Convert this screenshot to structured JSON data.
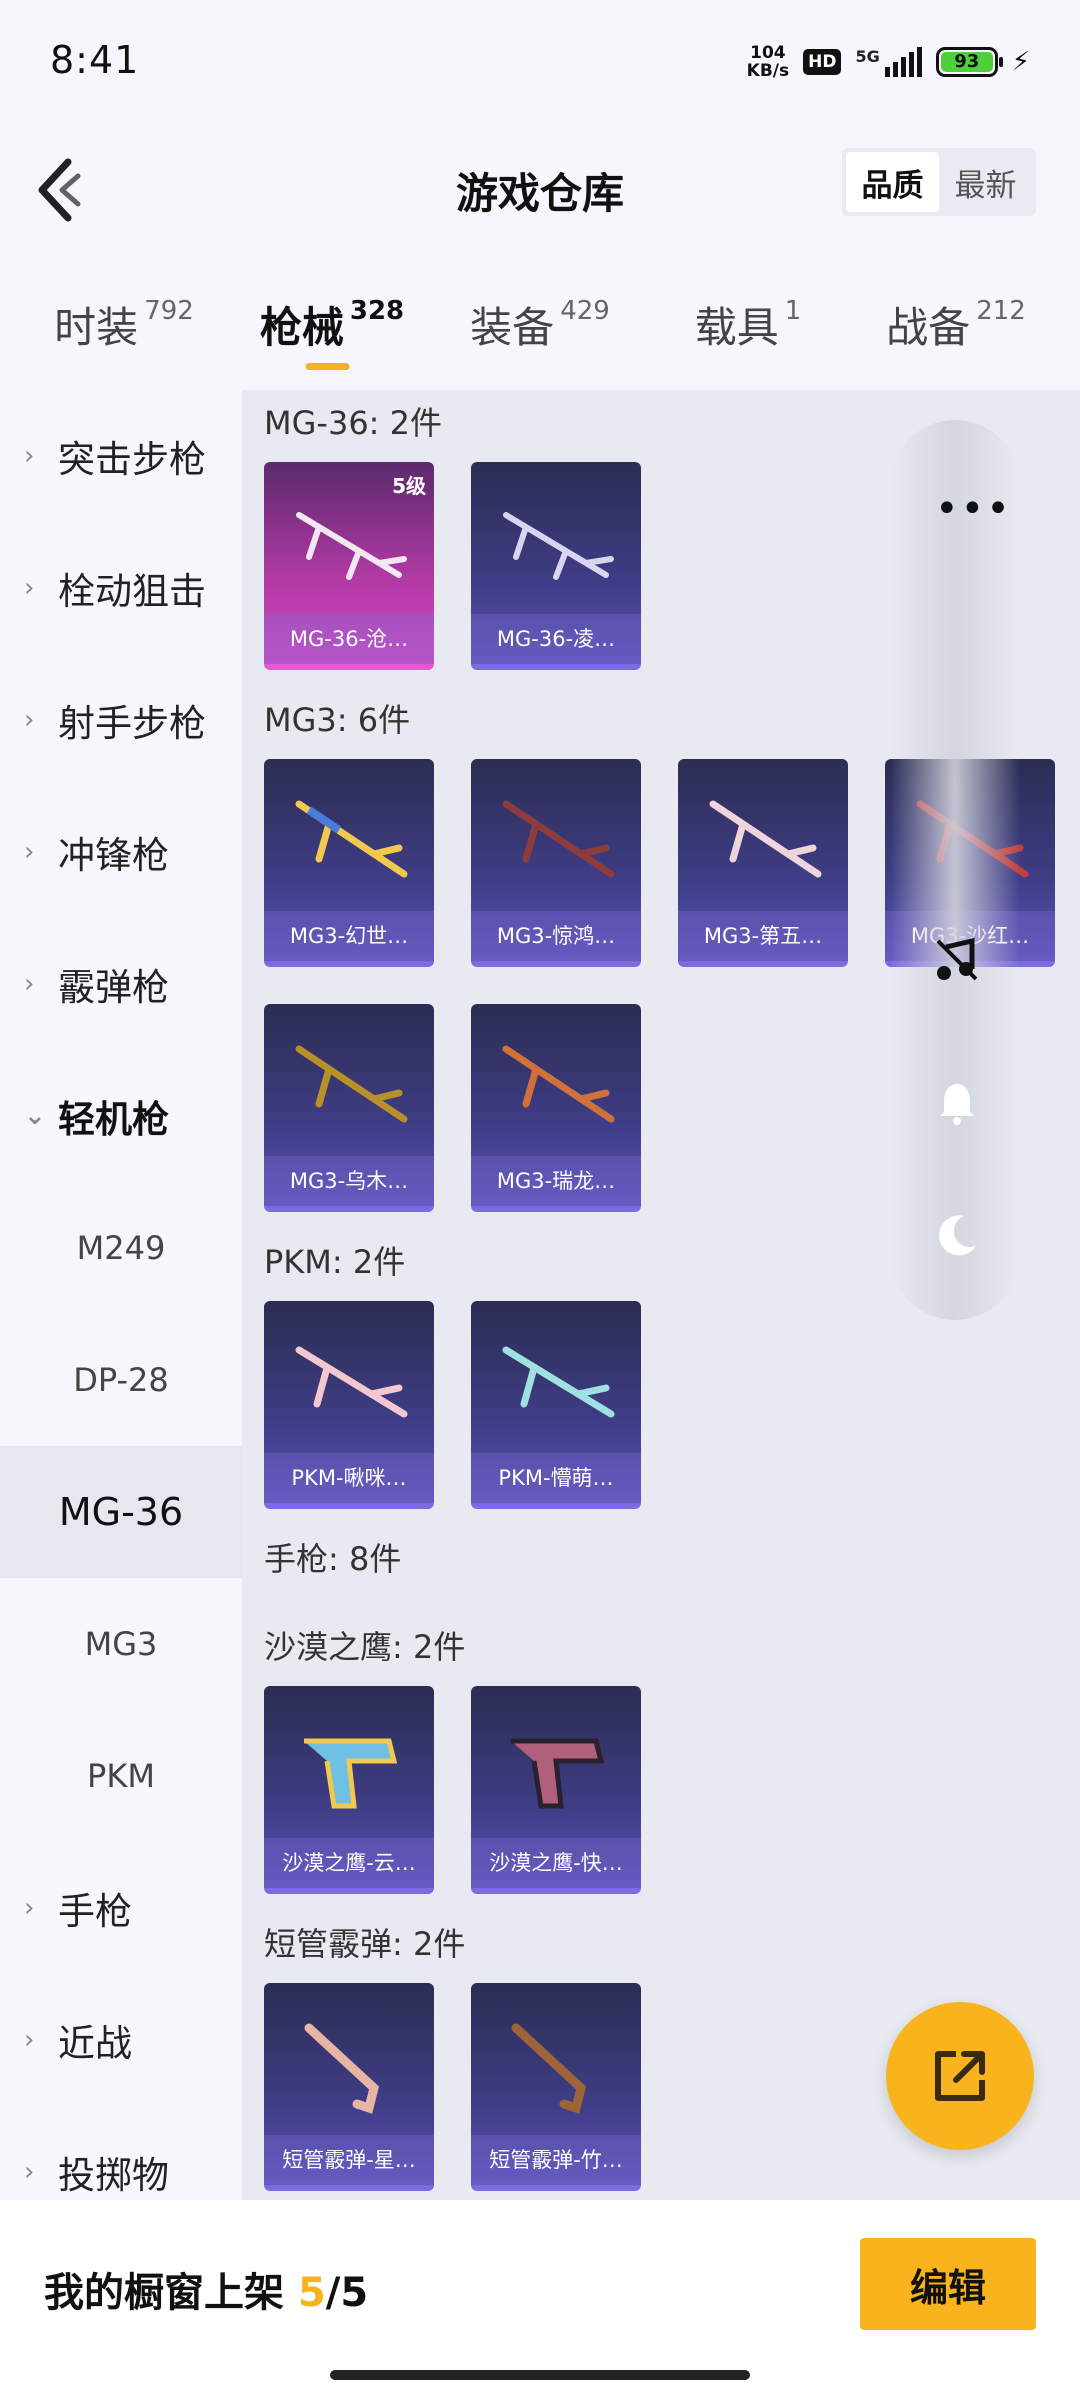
{
  "status": {
    "time": "8:41",
    "net_speed_value": "104",
    "net_speed_unit": "KB/s",
    "hd": "HD",
    "network": "5G",
    "battery": "93"
  },
  "header": {
    "title": "游戏仓库",
    "sort_options": [
      "品质",
      "最新"
    ],
    "sort_selected": "品质"
  },
  "tabs": [
    {
      "label": "时装",
      "count": "792"
    },
    {
      "label": "枪械",
      "count": "328",
      "active": true
    },
    {
      "label": "装备",
      "count": "429"
    },
    {
      "label": "载具",
      "count": "1"
    },
    {
      "label": "战备",
      "count": "212"
    }
  ],
  "sidebar": {
    "categories": [
      {
        "label": "突击步枪"
      },
      {
        "label": "栓动狙击"
      },
      {
        "label": "射手步枪"
      },
      {
        "label": "冲锋枪"
      },
      {
        "label": "霰弹枪"
      },
      {
        "label": "轻机枪",
        "open": true
      }
    ],
    "subitems": [
      "M249",
      "DP-28",
      "MG-36",
      "MG3",
      "PKM"
    ],
    "selected_sub": "MG-36",
    "more_categories": [
      {
        "label": "手枪"
      },
      {
        "label": "近战"
      },
      {
        "label": "投掷物"
      }
    ]
  },
  "content": {
    "groups": [
      {
        "title": "MG-36: 2件",
        "items": [
          {
            "name": "MG-36-沧…",
            "level": "5级",
            "rarity": "pink"
          },
          {
            "name": "MG-36-凌…"
          }
        ]
      },
      {
        "title": "MG3: 6件",
        "items": [
          {
            "name": "MG3-幻世…"
          },
          {
            "name": "MG3-惊鸿…"
          },
          {
            "name": "MG3-第五…"
          },
          {
            "name": "MG3-沙红…"
          },
          {
            "name": "MG3-乌木…"
          },
          {
            "name": "MG3-瑞龙…"
          }
        ]
      },
      {
        "title": "PKM: 2件",
        "items": [
          {
            "name": "PKM-啾咪…"
          },
          {
            "name": "PKM-懵萌…"
          }
        ]
      },
      {
        "title": "手枪: 8件",
        "items": []
      },
      {
        "title": "沙漠之鹰: 2件",
        "items": [
          {
            "name": "沙漠之鹰-云…"
          },
          {
            "name": "沙漠之鹰-快…"
          }
        ]
      },
      {
        "title": "短管霰弹: 2件",
        "items": [
          {
            "name": "短管霰弹-星…"
          },
          {
            "name": "短管霰弹-竹…"
          }
        ]
      }
    ]
  },
  "bottom": {
    "label": "我的橱窗上架 ",
    "current": "5",
    "total": "/5",
    "edit_label": "编辑"
  },
  "icons": {
    "back": "chevron-left-icon",
    "more": "more-dots-icon",
    "music": "music-off-icon",
    "bell": "bell-icon",
    "moon": "moon-icon",
    "share": "share-external-icon"
  },
  "colors": {
    "accent": "#f9b31c",
    "item_card": "#3f3d86",
    "item_card_rare": "#d84ac6"
  }
}
